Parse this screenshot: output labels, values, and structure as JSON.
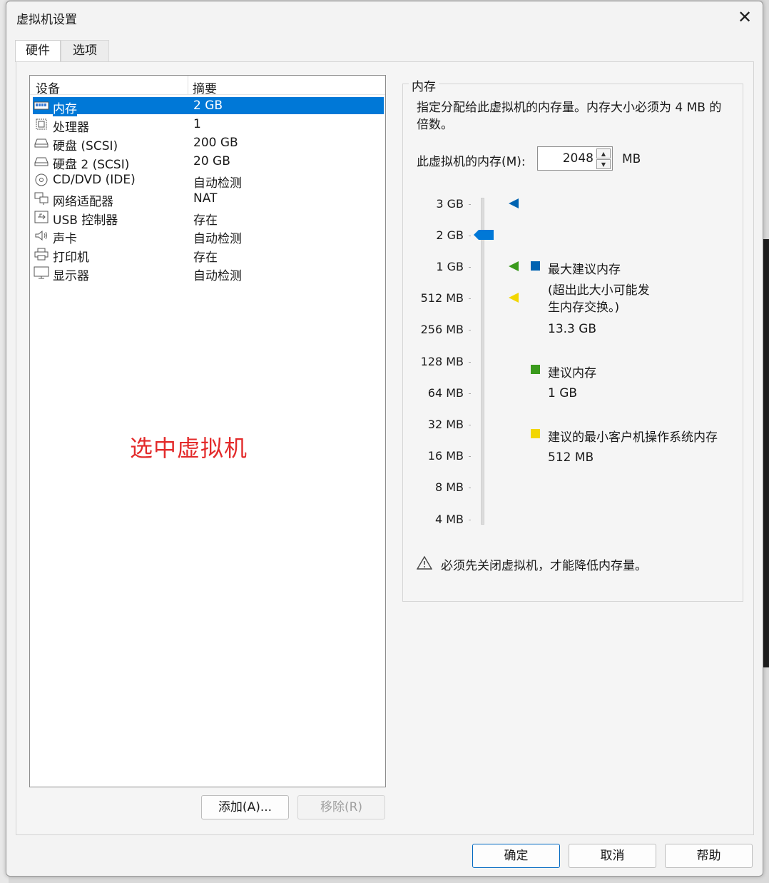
{
  "window": {
    "title": "虚拟机设置",
    "close_glyph": "✕"
  },
  "tabs": [
    {
      "label": "硬件"
    },
    {
      "label": "选项"
    }
  ],
  "device_table": {
    "headers": {
      "device": "设备",
      "summary": "摘要"
    },
    "rows": [
      {
        "name": "内存",
        "summary": "2 GB",
        "icon": "memory-icon",
        "selected": true
      },
      {
        "name": "处理器",
        "summary": "1",
        "icon": "processor-icon"
      },
      {
        "name": "硬盘 (SCSI)",
        "summary": "200 GB",
        "icon": "hard-disk-icon"
      },
      {
        "name": "硬盘 2 (SCSI)",
        "summary": "20 GB",
        "icon": "hard-disk-icon"
      },
      {
        "name": "CD/DVD (IDE)",
        "summary": "自动检测",
        "icon": "cd-dvd-icon"
      },
      {
        "name": "网络适配器",
        "summary": "NAT",
        "icon": "network-adapter-icon"
      },
      {
        "name": "USB 控制器",
        "summary": "存在",
        "icon": "usb-icon"
      },
      {
        "name": "声卡",
        "summary": "自动检测",
        "icon": "sound-card-icon"
      },
      {
        "name": "打印机",
        "summary": "存在",
        "icon": "printer-icon"
      },
      {
        "name": "显示器",
        "summary": "自动检测",
        "icon": "display-icon"
      }
    ]
  },
  "annotation": {
    "text": "选中虚拟机",
    "color": "#e32a2a"
  },
  "device_buttons": {
    "add": "添加(A)...",
    "remove": "移除(R)"
  },
  "memory": {
    "group_title": "内存",
    "description": "指定分配给此虚拟机的内存量。内存大小必须为 4 MB 的倍数。",
    "field_label": "此虚拟机的内存(M):",
    "value": "2048",
    "unit": "MB",
    "scale_ticks": [
      "3 GB",
      "2 GB",
      "1 GB",
      "512 MB",
      "256 MB",
      "128 MB",
      "64 MB",
      "32 MB",
      "16 MB",
      "8 MB",
      "4 MB"
    ],
    "slider_current": "2 GB",
    "legend": {
      "max": {
        "label": "最大建议内存",
        "note": "(超出此大小可能发生内存交换。)",
        "value": "13.3 GB",
        "color": "#0063b1"
      },
      "recommended": {
        "label": "建议内存",
        "value": "1 GB",
        "color": "#3a9a1c"
      },
      "min_guest": {
        "label": "建议的最小客户机操作系统内存",
        "value": "512 MB",
        "color": "#f2d600"
      }
    },
    "warning": "必须先关闭虚拟机，才能降低内存量。"
  },
  "dialog_buttons": {
    "ok": "确定",
    "cancel": "取消",
    "help": "帮助"
  },
  "colors": {
    "selection": "#0078d7",
    "accent": "#0067c0"
  }
}
